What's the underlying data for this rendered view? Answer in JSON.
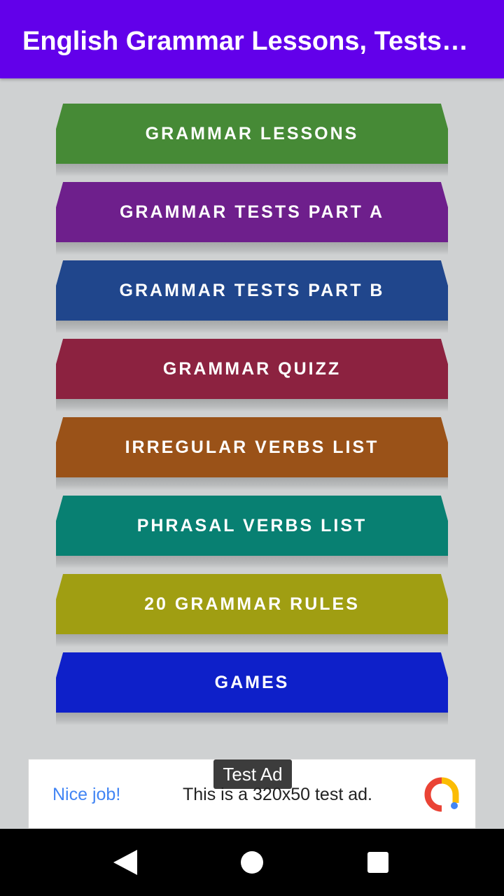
{
  "app_bar": {
    "title": "English Grammar Lessons, Tests…",
    "color": "#6200ea"
  },
  "menu": [
    {
      "label": "GRAMMAR LESSONS",
      "color": "#468a36"
    },
    {
      "label": "GRAMMAR TESTS PART A",
      "color": "#6e1f8c"
    },
    {
      "label": "GRAMMAR TESTS PART B",
      "color": "#20468c"
    },
    {
      "label": "GRAMMAR QUIZZ",
      "color": "#8c2240"
    },
    {
      "label": "IRREGULAR VERBS LIST",
      "color": "#9a5218"
    },
    {
      "label": "PHRASAL VERBS LIST",
      "color": "#088072"
    },
    {
      "label": "20 GRAMMAR RULES",
      "color": "#a09e12"
    },
    {
      "label": "GAMES",
      "color": "#0e20c9"
    }
  ],
  "ad": {
    "tag": "Test Ad",
    "headline": "Nice job!",
    "text": "This is a 320x50 test ad.",
    "logo_icon": "google-ads-icon"
  },
  "nav": {
    "back_icon": "back-triangle-icon",
    "home_icon": "home-circle-icon",
    "recent_icon": "recents-square-icon"
  }
}
